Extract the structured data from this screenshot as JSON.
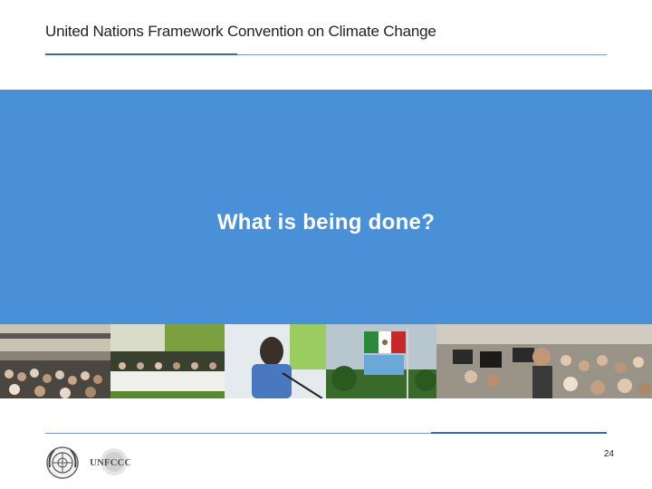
{
  "header": {
    "title": "United Nations Framework Convention on Climate Change"
  },
  "slide": {
    "title": "What is being done?"
  },
  "footer": {
    "page_number": "24",
    "logos": [
      "un-emblem-icon",
      "unfccc-logo-icon"
    ]
  },
  "colors": {
    "banner": "#4a90d9",
    "rule": "#3a6aa8"
  }
}
